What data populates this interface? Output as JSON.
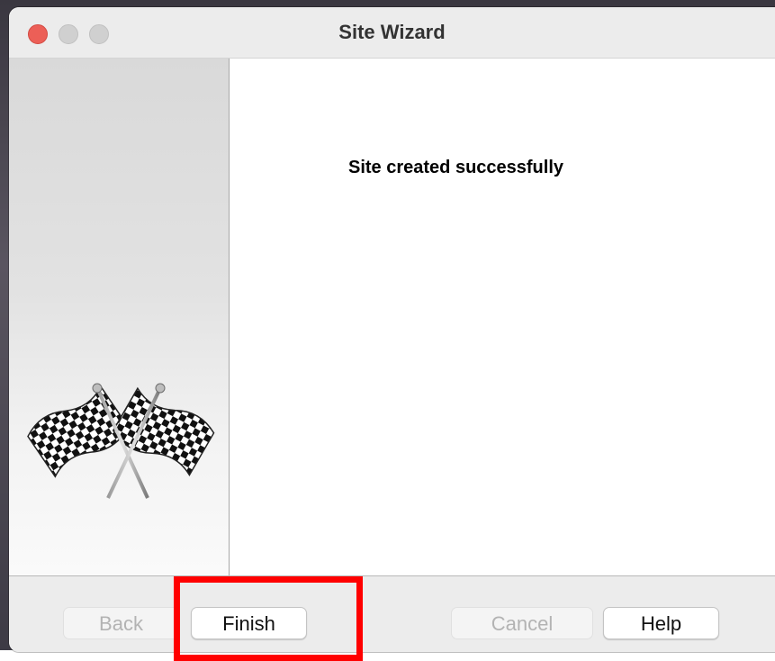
{
  "window": {
    "title": "Site Wizard"
  },
  "content": {
    "message": "Site created successfully"
  },
  "icons": {
    "side_image": "checkered-flags-icon"
  },
  "footer": {
    "back_label": "Back",
    "finish_label": "Finish",
    "cancel_label": "Cancel",
    "help_label": "Help"
  },
  "colors": {
    "close_button": "#ec5f57",
    "highlight_box": "#ff0000"
  }
}
